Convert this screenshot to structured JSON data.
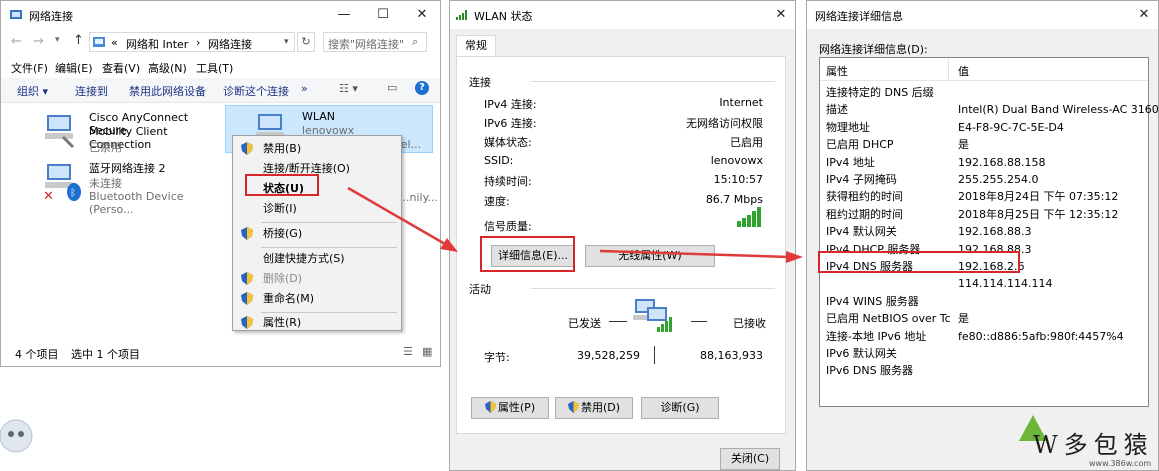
{
  "net_window": {
    "title": "网络连接",
    "address": {
      "sep1": "«",
      "crumb1": "网络和 Inter",
      "sep2": "›",
      "crumb2": "网络连接"
    },
    "search_placeholder": "搜索\"网络连接\"",
    "menubar": [
      "文件(F)",
      "编辑(E)",
      "查看(V)",
      "高级(N)",
      "工具(T)"
    ],
    "toolbar": {
      "organize": "组织 ▾",
      "connect": "连接到",
      "disable": "禁用此网络设备",
      "diagnose": "诊断这个连接",
      "more": "»"
    },
    "adapters": [
      {
        "name": "Cisco AnyConnect Secure",
        "name2": "Mobility Client Connection",
        "status": "已禁用"
      },
      {
        "name": "WLAN",
        "status": "lenovowx",
        "device": "...rel..."
      },
      {
        "name": "蓝牙网络连接 2",
        "status": "未连接",
        "device": "Bluetooth Device (Perso..."
      },
      {
        "device": "...nily..."
      }
    ],
    "statusbar": {
      "count": "4 个项目",
      "selected": "选中 1 个项目"
    }
  },
  "context_menu": {
    "items": [
      "禁用(B)",
      "连接/断开连接(O)",
      "状态(U)",
      "诊断(I)",
      "桥接(G)",
      "创建快捷方式(S)",
      "删除(D)",
      "重命名(M)",
      "属性(R)"
    ]
  },
  "status_window": {
    "title": "WLAN 状态",
    "tab": "常规",
    "connection_header": "连接",
    "rows": [
      {
        "label": "IPv4 连接:",
        "value": "Internet"
      },
      {
        "label": "IPv6 连接:",
        "value": "无网络访问权限"
      },
      {
        "label": "媒体状态:",
        "value": "已启用"
      },
      {
        "label": "SSID:",
        "value": "lenovowx"
      },
      {
        "label": "持续时间:",
        "value": "15:10:57"
      },
      {
        "label": "速度:",
        "value": "86.7 Mbps"
      }
    ],
    "signal_label": "信号质量:",
    "details_button": "详细信息(E)...",
    "wireless_button": "无线属性(W)",
    "activity_header": "活动",
    "sent_label": "已发送",
    "received_label": "已接收",
    "bytes_label": "字节:",
    "bytes_sent": "39,528,259",
    "bytes_received": "88,163,933",
    "properties_button": "属性(P)",
    "disable_button": "禁用(D)",
    "diagnose_button": "诊断(G)",
    "close_button": "关闭(C)"
  },
  "details_window": {
    "title": "网络连接详细信息",
    "subtitle": "网络连接详细信息(D):",
    "col_property": "属性",
    "col_value": "值",
    "rows": [
      {
        "p": "连接特定的 DNS 后缀",
        "v": ""
      },
      {
        "p": "描述",
        "v": "Intel(R) Dual Band Wireless-AC 3160"
      },
      {
        "p": "物理地址",
        "v": "E4-F8-9C-7C-5E-D4"
      },
      {
        "p": "已启用 DHCP",
        "v": "是"
      },
      {
        "p": "IPv4 地址",
        "v": "192.168.88.158"
      },
      {
        "p": "IPv4 子网掩码",
        "v": "255.255.254.0"
      },
      {
        "p": "获得租约的时间",
        "v": "2018年8月24日 下午 07:35:12"
      },
      {
        "p": "租约过期的时间",
        "v": "2018年8月25日 下午 12:35:12"
      },
      {
        "p": "IPv4 默认网关",
        "v": "192.168.88.3"
      },
      {
        "p": "IPv4 DHCP 服务器",
        "v": "192.168.88.3"
      },
      {
        "p": "IPv4 DNS 服务器",
        "v": "192.168.2.6"
      },
      {
        "p": "",
        "v": "114.114.114.114"
      },
      {
        "p": "IPv4 WINS 服务器",
        "v": ""
      },
      {
        "p": "已启用 NetBIOS over Tc",
        "v": "是"
      },
      {
        "p": "连接-本地 IPv6 地址",
        "v": "fe80::d886:5afb:980f:4457%4"
      },
      {
        "p": "IPv6 默认网关",
        "v": ""
      },
      {
        "p": "IPv6 DNS 服务器",
        "v": ""
      }
    ]
  },
  "watermark": {
    "text": "W多包猿",
    "site": "www.386w.com"
  },
  "colors": {
    "accent": "#d9262a",
    "select_bg": "#cce8ff",
    "link_blue": "#0066cc"
  }
}
